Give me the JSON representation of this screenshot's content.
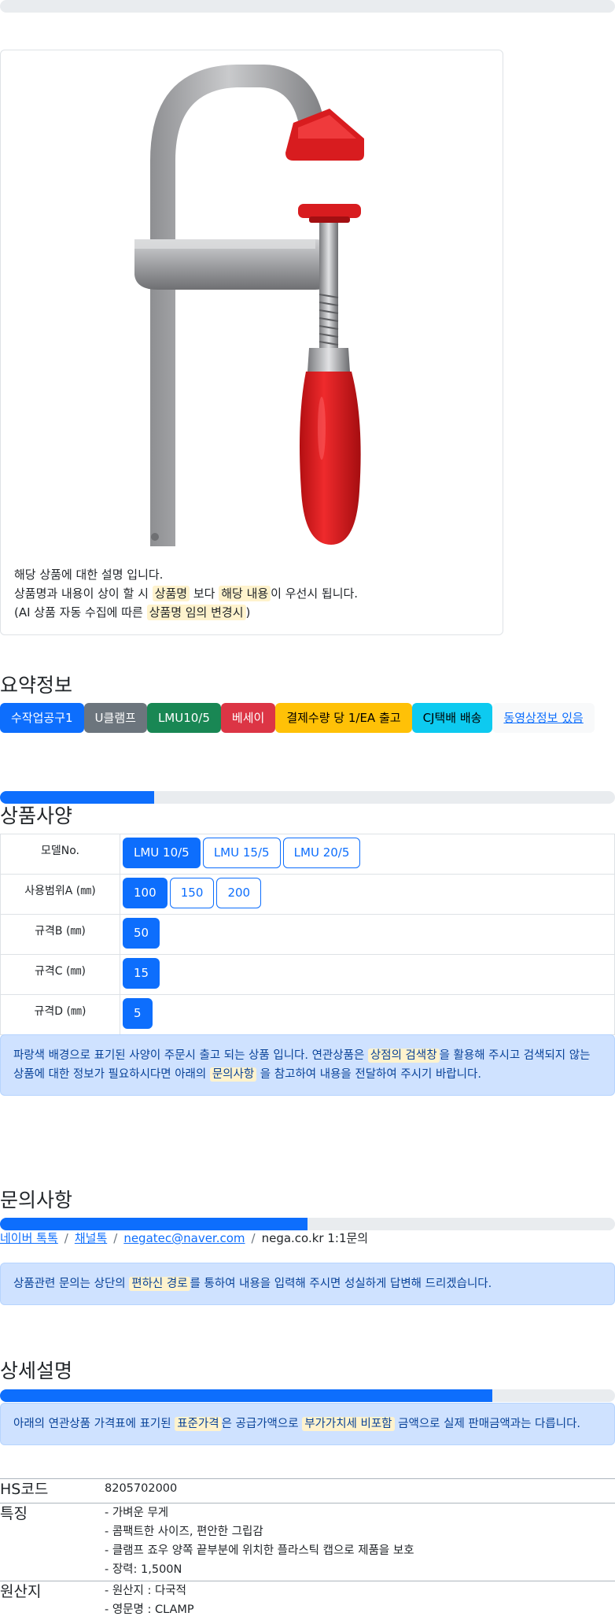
{
  "product_notice": {
    "line1": "해당 상품에 대한 설명 입니다.",
    "line2_pre": "상품명과 내용이 상이 할 시 ",
    "line2_hl1": "상품명",
    "line2_mid": " 보다 ",
    "line2_hl2": "해당 내용",
    "line2_post": "이 우선시 됩니다.",
    "line3_pre": "(AI 상품 자동 수집에 따른 ",
    "line3_hl": "상품명 임의 변경시",
    "line3_post": ")"
  },
  "summary": {
    "title": "요약정보",
    "badges": [
      "수작업공구1",
      "U클램프",
      "LMU10/5",
      "베세이",
      "결제수량 당 1/EA 출고",
      "CJ택배 배송",
      "동영상정보 있음"
    ]
  },
  "progress": {
    "spec": 0.25,
    "inquiry": 0.5,
    "detail": 0.8
  },
  "spec": {
    "title": "상품사양",
    "rows": [
      {
        "label": "모델No.",
        "options": [
          "LMU 10/5",
          "LMU 15/5",
          "LMU 20/5"
        ]
      },
      {
        "label": "사용범위A (㎜)",
        "options": [
          "100",
          "150",
          "200"
        ]
      },
      {
        "label": "규격B (㎜)",
        "options": [
          "50"
        ]
      },
      {
        "label": "규격C (㎜)",
        "options": [
          "15"
        ]
      },
      {
        "label": "규격D (㎜)",
        "options": [
          "5"
        ]
      }
    ],
    "notice_pre": "파랑색 배경으로 표기된 사양이 주문시 출고 되는 상품 입니다. 연관상품은 ",
    "notice_hl1": "상점의 검색창",
    "notice_mid": "을 활용해 주시고 검색되지 않는 상품에 대한 정보가 필요하시다면 아래의 ",
    "notice_hl2": "문의사항",
    "notice_post": " 을 참고하여 내용을 전달하여 주시기 바랍니다."
  },
  "inquiry": {
    "title": "문의사항",
    "links": [
      "네이버 톡톡",
      "채널톡",
      "negatec@naver.com"
    ],
    "plain": "nega.co.kr 1:1문의",
    "sep": "/",
    "notice_pre": "상품관련 문의는 상단의 ",
    "notice_hl": "편하신 경로",
    "notice_post": "를 통하여 내용을 입력해 주시면 성실하게 답변해 드리겠습니다."
  },
  "detail": {
    "title": "상세설명",
    "notice_pre": "아래의 연관상품 가격표에 표기된 ",
    "notice_hl1": "표준가격",
    "notice_mid": "은 공급가액으로 ",
    "notice_hl2": "부가가치세 비포함",
    "notice_post": " 금액으로 실제 판매금액과는 다릅니다.",
    "rows": [
      {
        "key": "HS코드",
        "lines": [
          "8205702000"
        ]
      },
      {
        "key": "특징",
        "lines": [
          "- 가벼운 무게",
          "- 콤팩트한 사이즈, 편안한 그립감",
          "- 클램프 죠우 양쪽 끝부분에 위치한 플라스틱 캡으로 제품을 보호",
          "- 장력: 1,500N"
        ]
      },
      {
        "key": "원산지",
        "lines": [
          "- 원산지 : 다국적",
          "- 영문명 : CLAMP"
        ]
      }
    ]
  },
  "colors": {
    "primary": "#0d6efd",
    "handle_red": "#e0161b",
    "steel": "#a8a8aa"
  },
  "icons": {
    "product_image": "f-clamp-image"
  }
}
